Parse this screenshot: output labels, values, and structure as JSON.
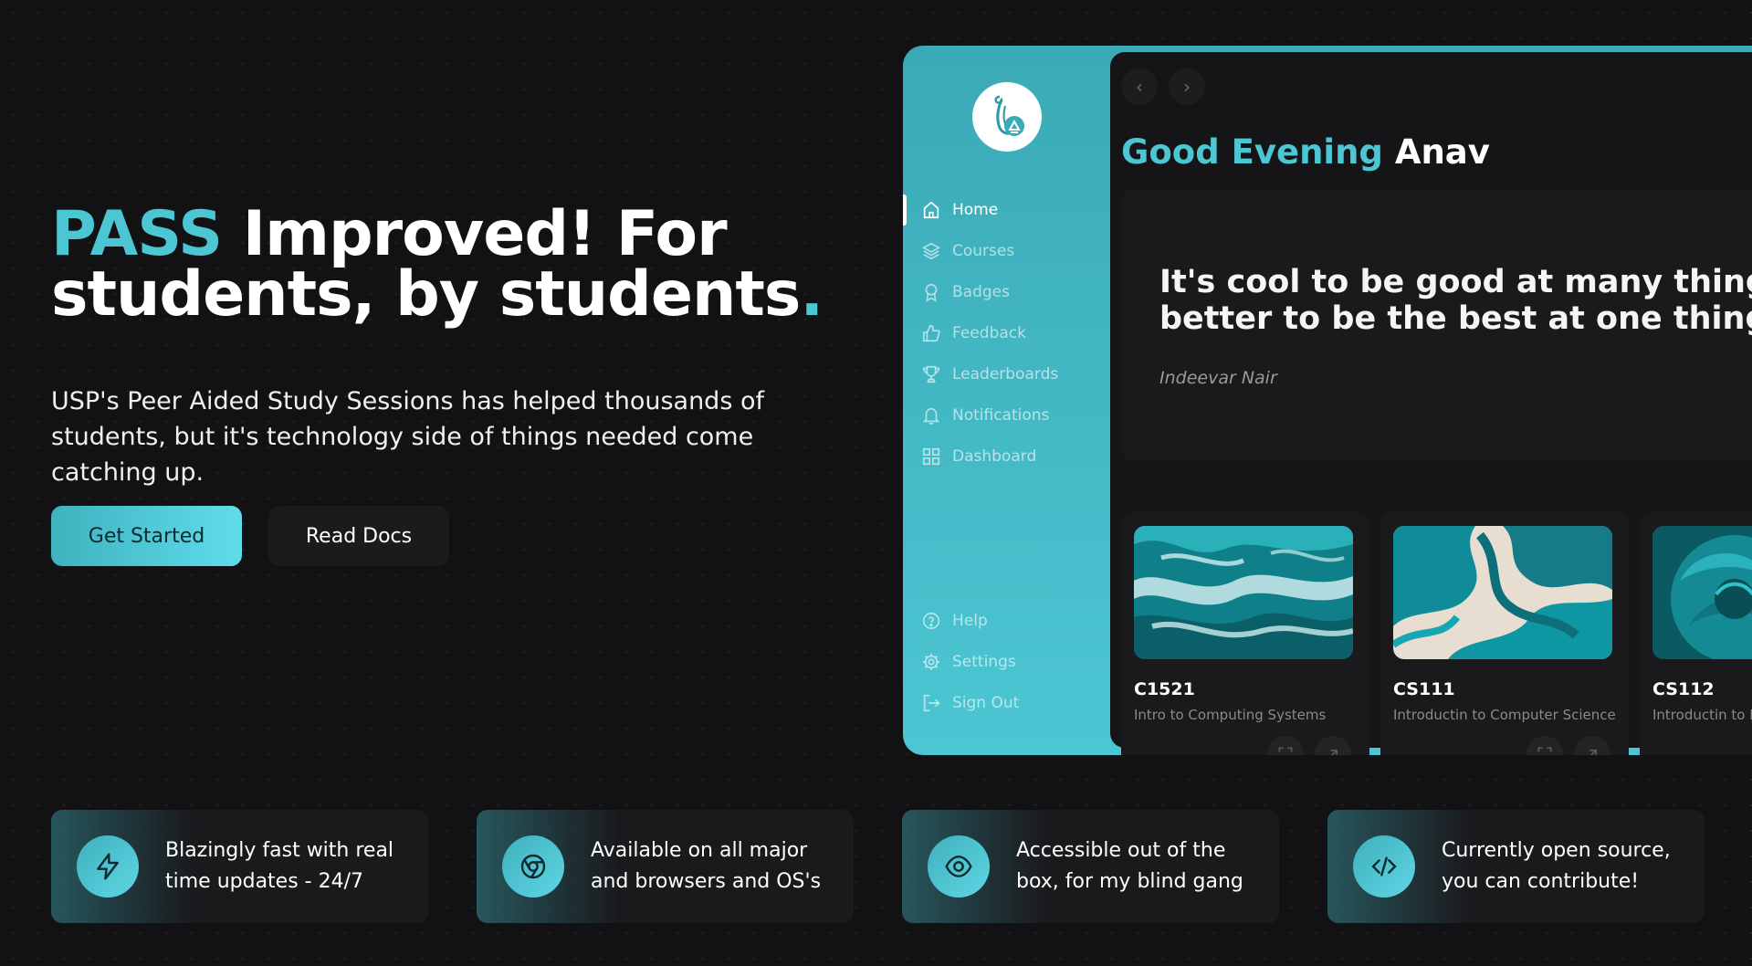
{
  "hero": {
    "title_accent": "PASS",
    "title_rest": " Improved! For students, by students",
    "title_dot": ".",
    "subtitle": "USP's Peer Aided Study Sessions has helped thousands of students, but it's technology side of things needed come catching up.",
    "primary_button": "Get Started",
    "secondary_button": "Read Docs"
  },
  "app": {
    "nav": [
      {
        "label": "Home",
        "icon": "home-icon"
      },
      {
        "label": "Courses",
        "icon": "layers-icon"
      },
      {
        "label": "Badges",
        "icon": "badge-icon"
      },
      {
        "label": "Feedback",
        "icon": "thumbs-up-icon"
      },
      {
        "label": "Leaderboards",
        "icon": "trophy-icon"
      },
      {
        "label": "Notifications",
        "icon": "bell-icon"
      },
      {
        "label": "Dashboard",
        "icon": "grid-icon"
      }
    ],
    "bottom_nav": [
      {
        "label": "Help",
        "icon": "help-icon"
      },
      {
        "label": "Settings",
        "icon": "gear-icon"
      },
      {
        "label": "Sign Out",
        "icon": "sign-out-icon"
      }
    ],
    "greeting_prefix": "Good Evening",
    "greeting_name": "Anav",
    "quote": {
      "line1": "It's cool to be good at many things, but",
      "line2": "better to be the best at one thing.",
      "author": "Indeevar Nair"
    },
    "courses": [
      {
        "code": "C1521",
        "name": "Intro to Computing Systems"
      },
      {
        "code": "CS111",
        "name": "Introductin to Computer Science"
      },
      {
        "code": "CS112",
        "name": "Introductin to D"
      }
    ]
  },
  "features": [
    {
      "icon": "lightning-icon",
      "text": "Blazingly fast with real time updates - 24/7"
    },
    {
      "icon": "chrome-icon",
      "text": "Available on all major and browsers and OS's"
    },
    {
      "icon": "eye-icon",
      "text": "Accessible out of the box, for my blind gang"
    },
    {
      "icon": "code-icon",
      "text": "Currently open source, you can contribute!"
    }
  ],
  "colors": {
    "accent": "#4cc6d3",
    "background": "#121214",
    "card": "#1a1a1c"
  }
}
